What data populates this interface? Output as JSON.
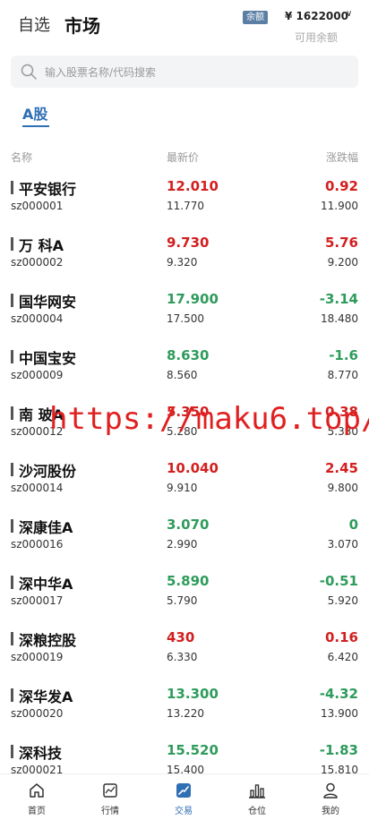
{
  "header": {
    "tab_watchlist": "自选",
    "tab_market": "市场",
    "balance_badge": "余额",
    "balance_amount": "¥ 1622000",
    "balance_caret": "∨",
    "balance_label": "可用余额"
  },
  "search": {
    "placeholder": "输入股票名称/代码搜索"
  },
  "market_tabs": [
    {
      "label": "A股",
      "active": true
    }
  ],
  "columns": {
    "name": "名称",
    "price": "最新价",
    "change": "涨跌幅"
  },
  "stocks": [
    {
      "name": "平安银行",
      "code": "sz000001",
      "price": "12.010",
      "prev": "11.770",
      "change": "0.92",
      "ref": "11.900",
      "direction": "up"
    },
    {
      "name": "万 科A",
      "code": "sz000002",
      "price": "9.730",
      "prev": "9.320",
      "change": "5.76",
      "ref": "9.200",
      "direction": "up"
    },
    {
      "name": "国华网安",
      "code": "sz000004",
      "price": "17.900",
      "prev": "17.500",
      "change": "-3.14",
      "ref": "18.480",
      "direction": "down"
    },
    {
      "name": "中国宝安",
      "code": "sz000009",
      "price": "8.630",
      "prev": "8.560",
      "change": "-1.6",
      "ref": "8.770",
      "direction": "down"
    },
    {
      "name": "南 玻A",
      "code": "sz000012",
      "price": "5.350",
      "prev": "5.280",
      "change": "0.38",
      "ref": "5.330",
      "direction": "up"
    },
    {
      "name": "沙河股份",
      "code": "sz000014",
      "price": "10.040",
      "prev": "9.910",
      "change": "2.45",
      "ref": "9.800",
      "direction": "up"
    },
    {
      "name": "深康佳A",
      "code": "sz000016",
      "price": "3.070",
      "prev": "2.990",
      "change": "0",
      "ref": "3.070",
      "direction": "down"
    },
    {
      "name": "深中华A",
      "code": "sz000017",
      "price": "5.890",
      "prev": "5.790",
      "change": "-0.51",
      "ref": "5.920",
      "direction": "down"
    },
    {
      "name": "深粮控股",
      "code": "sz000019",
      "price": "430",
      "prev": "6.330",
      "change": "0.16",
      "ref": "6.420",
      "direction": "up"
    },
    {
      "name": "深华发A",
      "code": "sz000020",
      "price": "13.300",
      "prev": "13.220",
      "change": "-4.32",
      "ref": "13.900",
      "direction": "down"
    },
    {
      "name": "深科技",
      "code": "sz000021",
      "price": "15.520",
      "prev": "15.400",
      "change": "-1.83",
      "ref": "15.810",
      "direction": "down"
    }
  ],
  "watermark": "https://maku6.top/",
  "tabbar": [
    {
      "label": "首页",
      "icon": "home-icon",
      "active": false
    },
    {
      "label": "行情",
      "icon": "chart-icon",
      "active": false
    },
    {
      "label": "交易",
      "icon": "trade-icon",
      "active": true
    },
    {
      "label": "仓位",
      "icon": "position-icon",
      "active": false
    },
    {
      "label": "我的",
      "icon": "user-icon",
      "active": false
    }
  ],
  "colors": {
    "up": "#d21f1f",
    "down": "#2e9b5c",
    "accent": "#2f6fb4",
    "badge": "#5b7fa4"
  }
}
